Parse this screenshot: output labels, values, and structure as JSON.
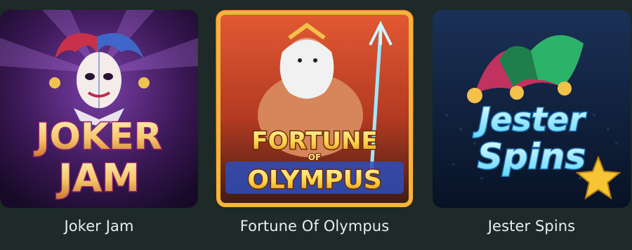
{
  "games": [
    {
      "title": "Joker Jam",
      "logo_lines": [
        "JOKER",
        "JAM"
      ],
      "art_icon": "joker-jester-portrait",
      "colors": {
        "bg_top": "#3b1856",
        "bg_bottom": "#1f0d33",
        "logo_fill": "#f4c56a",
        "logo_outline": "#8b1e6e"
      }
    },
    {
      "title": "Fortune Of Olympus",
      "logo_lines": [
        "FORTUNE",
        "OF",
        "OLYMPUS"
      ],
      "art_icon": "zeus-with-trident",
      "colors": {
        "bg_top": "#c6432a",
        "bg_bottom": "#3a1a12",
        "logo_fill": "#ffd34a",
        "logo_outline": "#6a2a06"
      }
    },
    {
      "title": "Jester Spins",
      "logo_lines": [
        "Jester",
        "Spins"
      ],
      "art_icon": "jester-hat-with-star",
      "colors": {
        "bg_top": "#162a4a",
        "bg_bottom": "#0b1426",
        "logo_fill": "#7ee7ff",
        "logo_outline": "#1a6fb0"
      }
    }
  ]
}
